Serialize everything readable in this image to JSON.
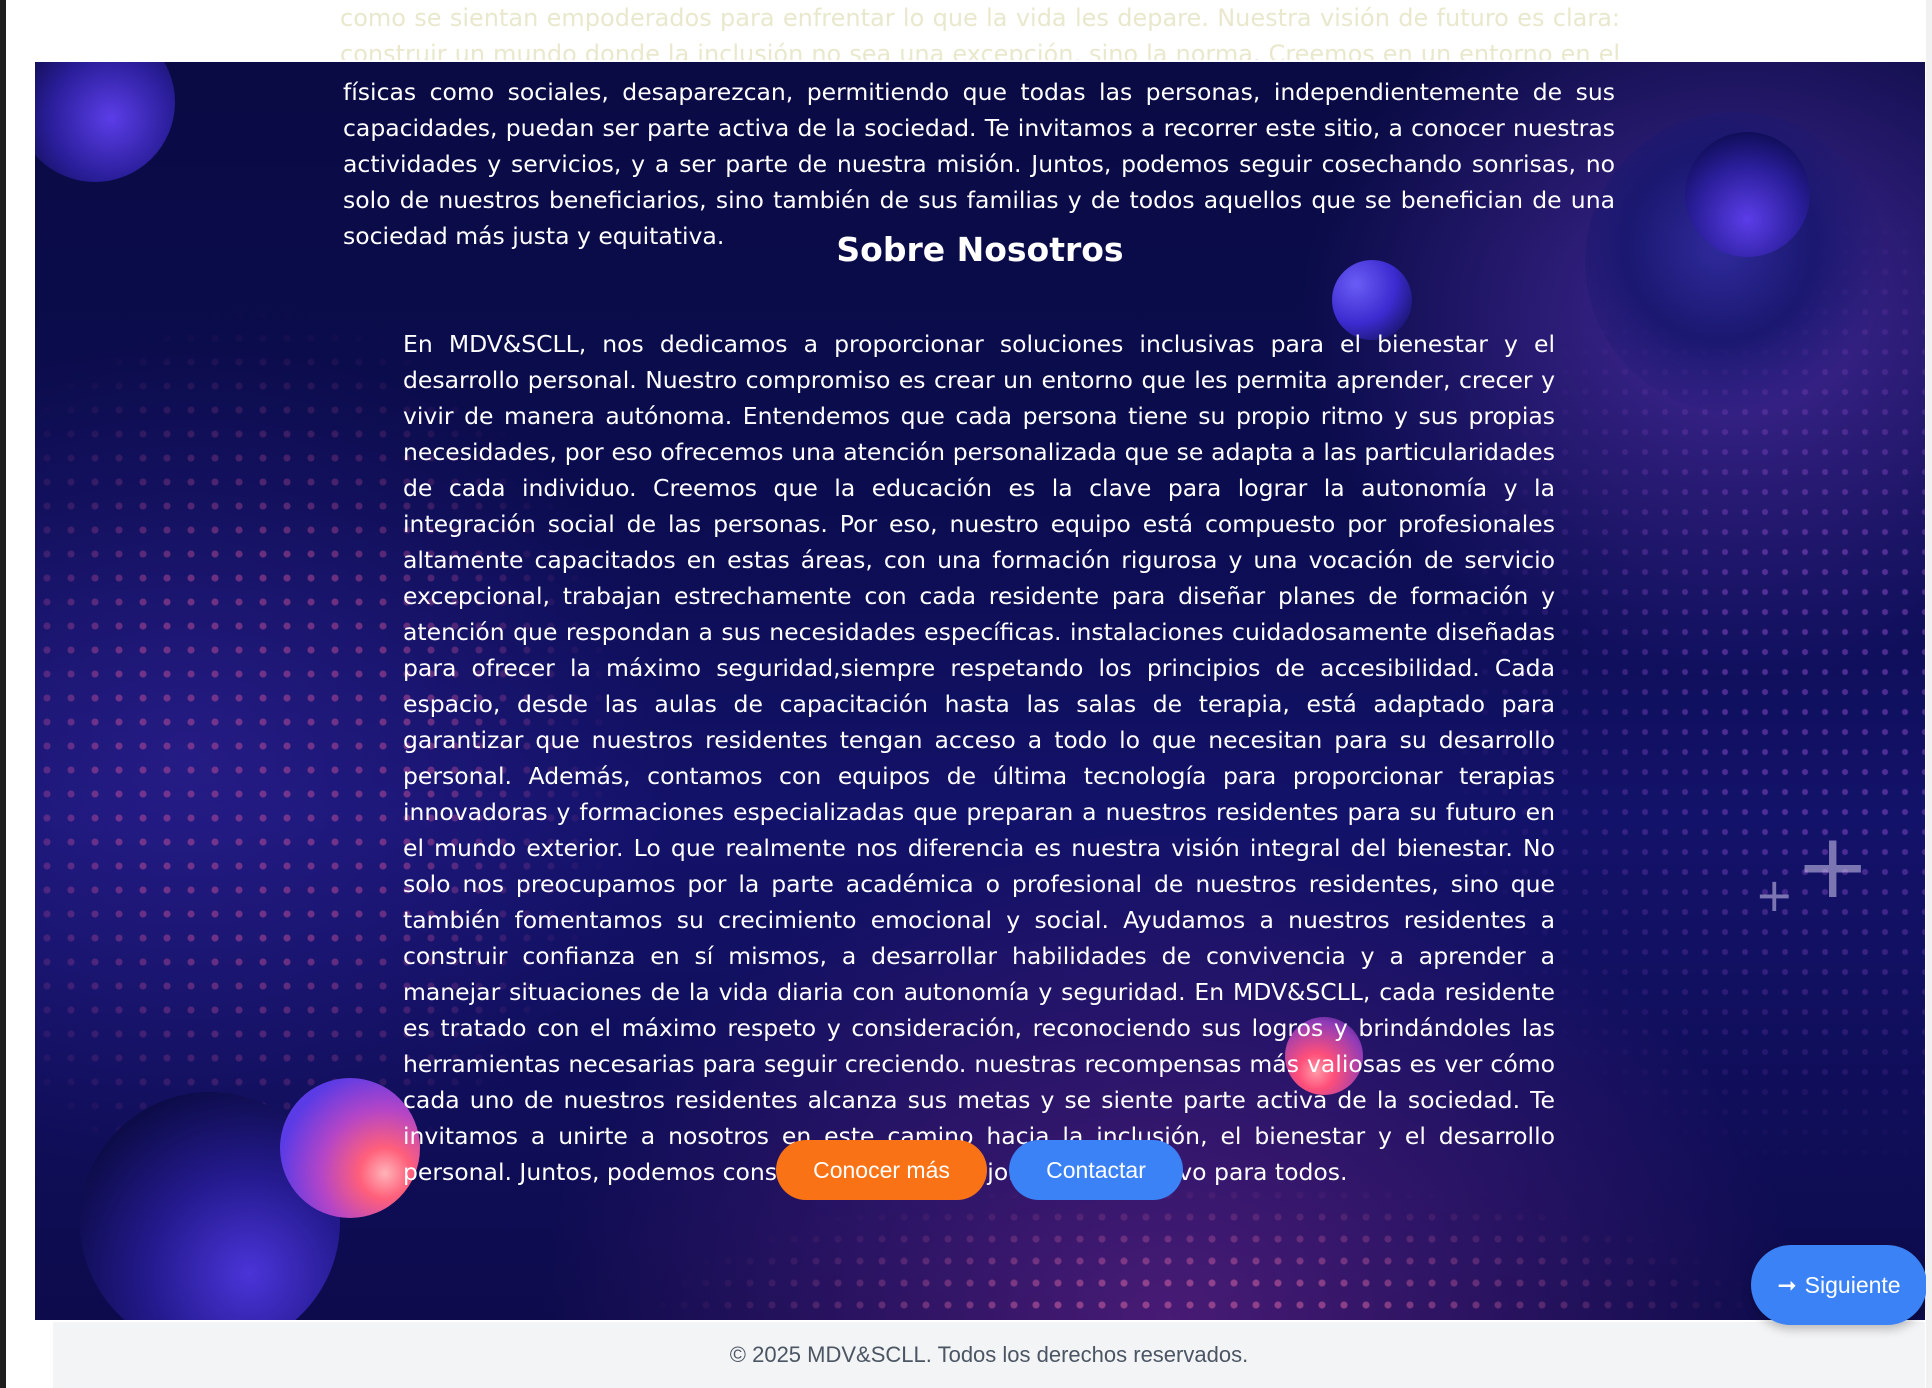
{
  "top_ghost_text": "como se sientan empoderados para enfrentar lo que la vida les depare. Nuestra visión de futuro es clara: construir un mundo donde la inclusión no sea una excepción, sino la norma. Creemos en un entorno en el que las barreras, tanto",
  "intro": {
    "text": "físicas como sociales, desaparezcan, permitiendo que todas las personas, independientemente de sus capacidades, puedan ser parte activa de la sociedad. Te invitamos a recorrer este sitio, a conocer nuestras actividades y servicios, y a ser parte de nuestra misión. Juntos, podemos seguir cosechando sonrisas, no solo de nuestros beneficiarios, sino también de sus familias y de todos aquellos que se benefician de una sociedad más justa y equitativa."
  },
  "about": {
    "title": "Sobre Nosotros",
    "text": "En MDV&SCLL, nos dedicamos a proporcionar soluciones inclusivas para el bienestar y el desarrollo personal. Nuestro compromiso es crear un entorno que les permita aprender, crecer y vivir de manera autónoma. Entendemos que cada persona tiene su propio ritmo y sus propias necesidades, por eso ofrecemos una atención personalizada que se adapta a las particularidades de cada individuo. Creemos que la educación es la clave para lograr la autonomía y la integración social de las personas. Por eso, nuestro equipo está compuesto por profesionales altamente capacitados en estas áreas, con una formación rigurosa y una vocación de servicio excepcional, trabajan estrechamente con cada residente para diseñar planes de formación y atención que respondan a sus necesidades específicas. instalaciones cuidadosamente diseñadas para ofrecer la máximo seguridad,siempre respetando los principios de accesibilidad. Cada espacio, desde las aulas de capacitación hasta las salas de terapia, está adaptado para garantizar que nuestros residentes tengan acceso a todo lo que necesitan para su desarrollo personal. Además, contamos con equipos de última tecnología para proporcionar terapias innovadoras y formaciones especializadas que preparan a nuestros residentes para su futuro en el mundo exterior. Lo que realmente nos diferencia es nuestra visión integral del bienestar. No solo nos preocupamos por la parte académica o profesional de nuestros residentes, sino que también fomentamos su crecimiento emocional y social. Ayudamos a nuestros residentes a construir confianza en sí mismos, a desarrollar habilidades de convivencia y a aprender a manejar situaciones de la vida diaria con autonomía y seguridad. En MDV&SCLL, cada residente es tratado con el máximo respeto y consideración, reconociendo sus logros y brindándoles las herramientas necesarias para seguir creciendo. nuestras recompensas más valiosas es ver cómo cada uno de nuestros residentes alcanza sus metas y se siente parte activa de la sociedad. Te invitamos a unirte a nosotros en este camino hacia la inclusión, el bienestar y el desarrollo personal. Juntos, podemos construir un futuro mejor y más inclusivo para todos."
  },
  "buttons": {
    "more_label": "Conocer más",
    "contact_label": "Contactar",
    "next_label": "Siguiente",
    "next_icon": "arrow-right-icon"
  },
  "footer": {
    "text": "© 2025 MDV&SCLL. Todos los derechos reservados."
  },
  "colors": {
    "more_button": "#f97316",
    "contact_button": "#3b82f6",
    "next_button": "#3b82f6",
    "footer_bg": "#f3f4f6",
    "hero_bg": "#0b0c4f"
  }
}
